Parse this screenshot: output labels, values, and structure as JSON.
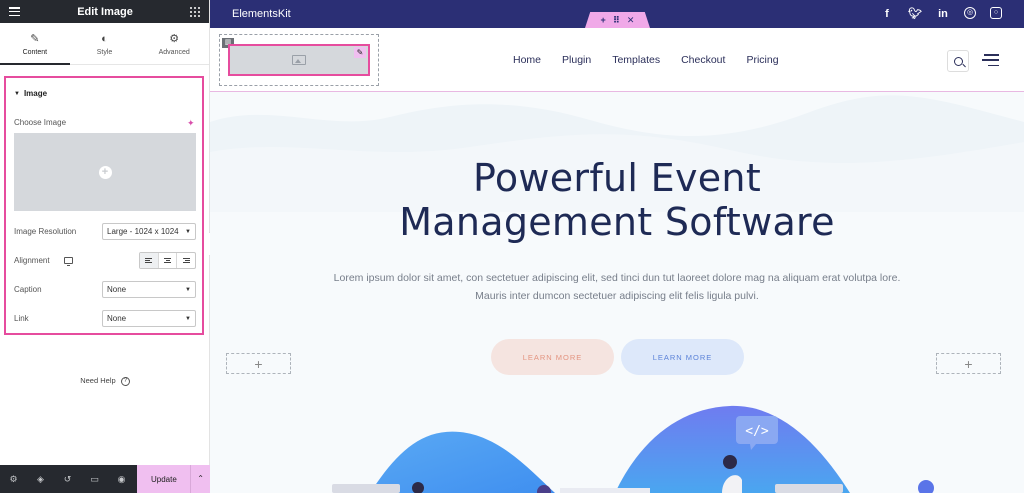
{
  "panel": {
    "title": "Edit Image",
    "tabs": [
      {
        "label": "Content",
        "icon": "pencil-icon",
        "active": true
      },
      {
        "label": "Style",
        "icon": "half-circle-icon",
        "active": false
      },
      {
        "label": "Advanced",
        "icon": "gear-icon",
        "active": false
      }
    ],
    "section_title": "Image",
    "choose_image_label": "Choose Image",
    "image_resolution_label": "Image Resolution",
    "image_resolution_value": "Large - 1024 x 1024",
    "alignment_label": "Alignment",
    "alignment_options": [
      "left",
      "center",
      "right"
    ],
    "alignment_selected": "left",
    "caption_label": "Caption",
    "caption_value": "None",
    "link_label": "Link",
    "link_value": "None",
    "need_help": "Need Help",
    "update_label": "Update",
    "footer_icons": [
      "settings-icon",
      "layers-icon",
      "history-icon",
      "responsive-icon",
      "eye-icon"
    ]
  },
  "preview": {
    "brand": "ElementsKit",
    "socials": [
      "facebook-icon",
      "twitter-icon",
      "linkedin-icon",
      "dribbble-icon",
      "instagram-icon"
    ],
    "nav": [
      "Home",
      "Plugin",
      "Templates",
      "Checkout",
      "Pricing"
    ],
    "hero_title_line1": "Powerful Event",
    "hero_title_line2": "Management Software",
    "hero_text_line1": "Lorem ipsum dolor sit amet, con sectetuer adipiscing elit, sed tinci dun tut laoreet dolore mag na aliquam erat volutpa lore.",
    "hero_text_line2": "Mauris inter dumcon sectetuer adipiscing elit felis ligula pulvi.",
    "button1": "LEARN MORE",
    "button2": "LEARN MORE"
  },
  "colors": {
    "panel_dark": "#26292f",
    "accent_pink": "#e64c9e",
    "topbar": "#2b2f75",
    "hero_text": "#1e2a55"
  }
}
